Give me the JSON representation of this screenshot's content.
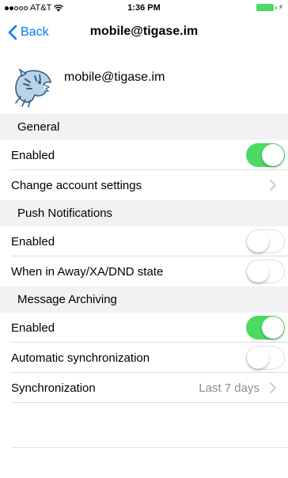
{
  "status_bar": {
    "carrier": "AT&T",
    "time": "1:36 PM",
    "signal_icon": "signal-dots-icon",
    "wifi_icon": "wifi-icon",
    "battery_icon": "battery-charging-icon",
    "battery_color": "#4cd964"
  },
  "nav": {
    "back_label": "Back",
    "title": "mobile@tigase.im",
    "accent_color": "#007aff"
  },
  "account": {
    "name": "mobile@tigase.im",
    "avatar_icon": "tiger-avatar-icon"
  },
  "sections": {
    "general": {
      "header": "General",
      "enabled_label": "Enabled",
      "enabled_on": true,
      "change_settings_label": "Change account settings"
    },
    "push": {
      "header": "Push Notifications",
      "enabled_label": "Enabled",
      "enabled_on": false,
      "away_label": "When in Away/XA/DND state",
      "away_on": false
    },
    "archiving": {
      "header": "Message Archiving",
      "enabled_label": "Enabled",
      "enabled_on": true,
      "auto_sync_label": "Automatic synchronization",
      "auto_sync_on": false,
      "sync_label": "Synchronization",
      "sync_value": "Last 7 days"
    }
  },
  "colors": {
    "toggle_on": "#4cd964",
    "section_bg": "#f2f2f5",
    "secondary_text": "#8e8e93"
  }
}
